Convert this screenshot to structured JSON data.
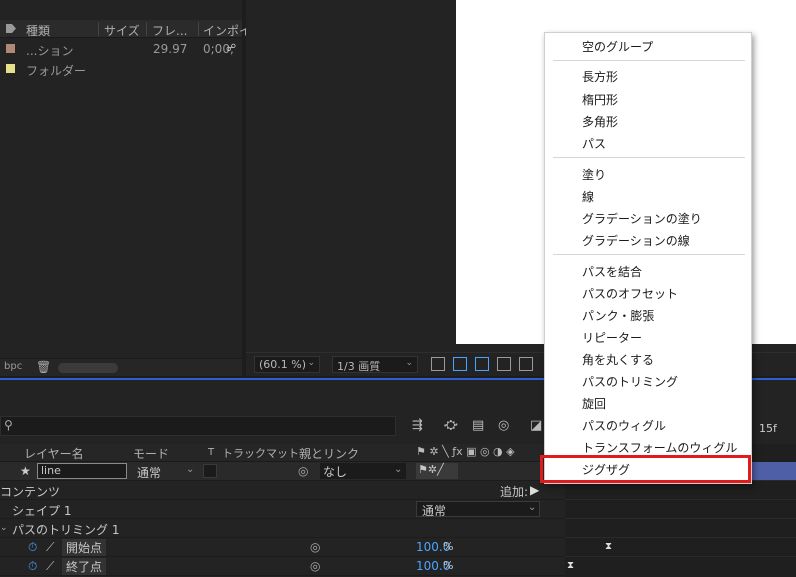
{
  "project": {
    "columns": [
      "種類",
      "サイズ",
      "フレ...",
      "インポイ"
    ],
    "items": [
      {
        "name": "...ション",
        "fps": "29.97",
        "inpoint": "0;00;",
        "color": "#b08878"
      },
      {
        "name": "フォルダー",
        "color": "#e6e08a"
      }
    ],
    "footer_bpc": "bpc"
  },
  "comp": {
    "zoom": "(60.1 %)",
    "quality": "1/3 画質"
  },
  "timeline": {
    "columns": {
      "layer_name": "レイヤー名",
      "mode": "モード",
      "track_t": "T",
      "track_matte": "トラックマット",
      "parent": "親とリンク"
    },
    "layer": {
      "name": "line",
      "mode": "通常",
      "parent": "なし"
    },
    "contents": "コンテンツ",
    "add": "追加:",
    "shape": "シェイプ 1",
    "shape_mode": "通常",
    "trim": "パスのトリミング 1",
    "start": {
      "label": "開始点",
      "value": "100.0",
      "unit": "%"
    },
    "end": {
      "label": "終了点",
      "value": "100.0",
      "unit": "%"
    },
    "ruler_label": "15f"
  },
  "menu": {
    "items": [
      "空のグループ",
      "長方形",
      "楕円形",
      "多角形",
      "パス",
      "塗り",
      "線",
      "グラデーションの塗り",
      "グラデーションの線",
      "パスを結合",
      "パスのオフセット",
      "パンク・膨張",
      "リピーター",
      "角を丸くする",
      "パスのトリミング",
      "旋回",
      "パスのウィグル",
      "トランスフォームのウィグル",
      "ジグザグ"
    ],
    "highlight_color": "#e01b1b"
  }
}
